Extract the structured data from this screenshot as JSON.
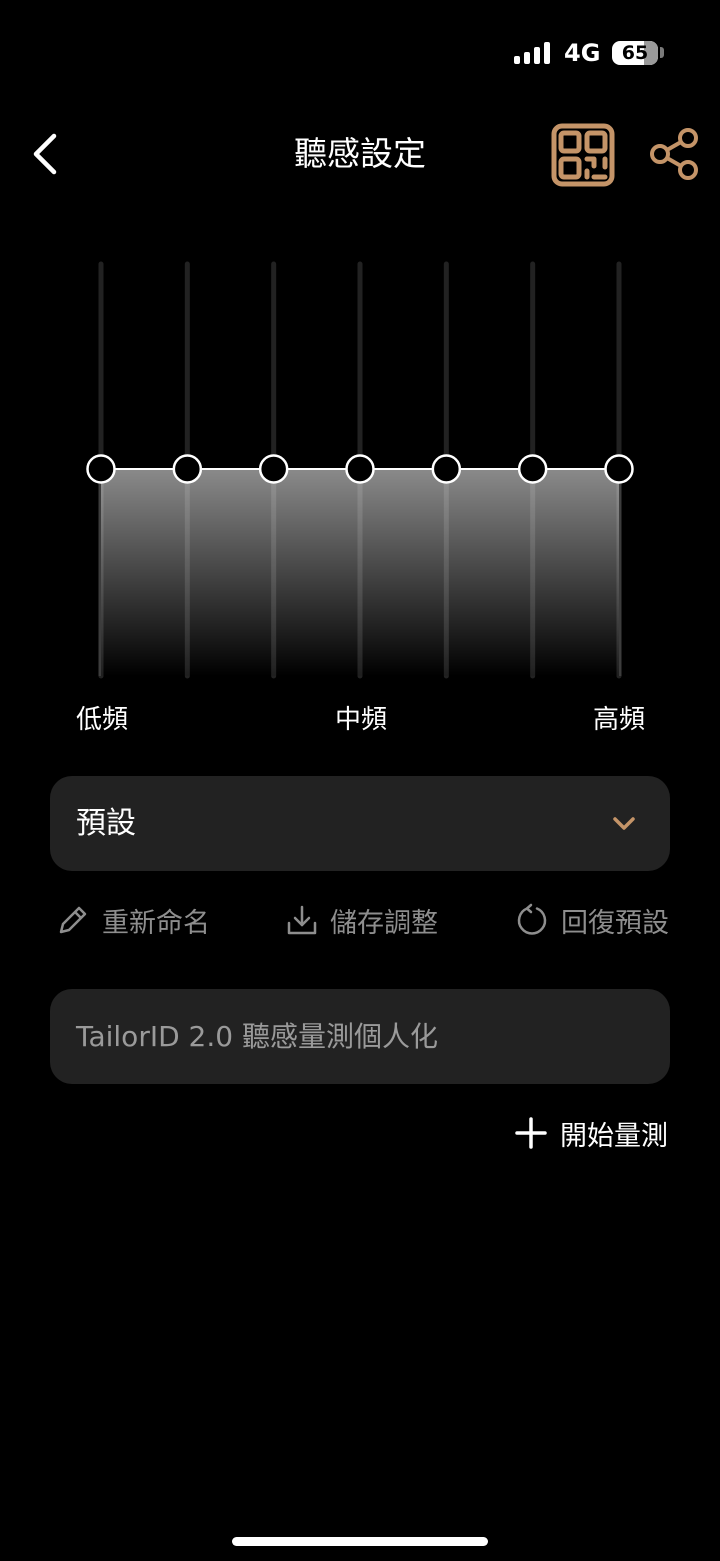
{
  "status": {
    "network": "4G",
    "battery": "65"
  },
  "header": {
    "title": "聽感設定"
  },
  "colors": {
    "accent": "#c49468",
    "panel": "#222222",
    "muted": "#8e8e8e"
  },
  "icons": {
    "back": "chevron-left-icon",
    "qr": "qr-code-icon",
    "share": "share-icon",
    "dropdown": "chevron-down-icon",
    "rename": "pencil-icon",
    "save": "download-icon",
    "reset": "reset-icon",
    "add": "plus-icon"
  },
  "equalizer": {
    "bands": 7,
    "levels": [
      0,
      0,
      0,
      0,
      0,
      0,
      0
    ],
    "labels": {
      "low": "低頻",
      "mid": "中頻",
      "high": "高頻"
    }
  },
  "preset": {
    "selected": "預設"
  },
  "actions": {
    "rename": "重新命名",
    "save": "儲存調整",
    "reset": "回復預設"
  },
  "tailor": {
    "label": "TailorID 2.0 聽感量測個人化"
  },
  "start": {
    "label": "開始量測"
  }
}
